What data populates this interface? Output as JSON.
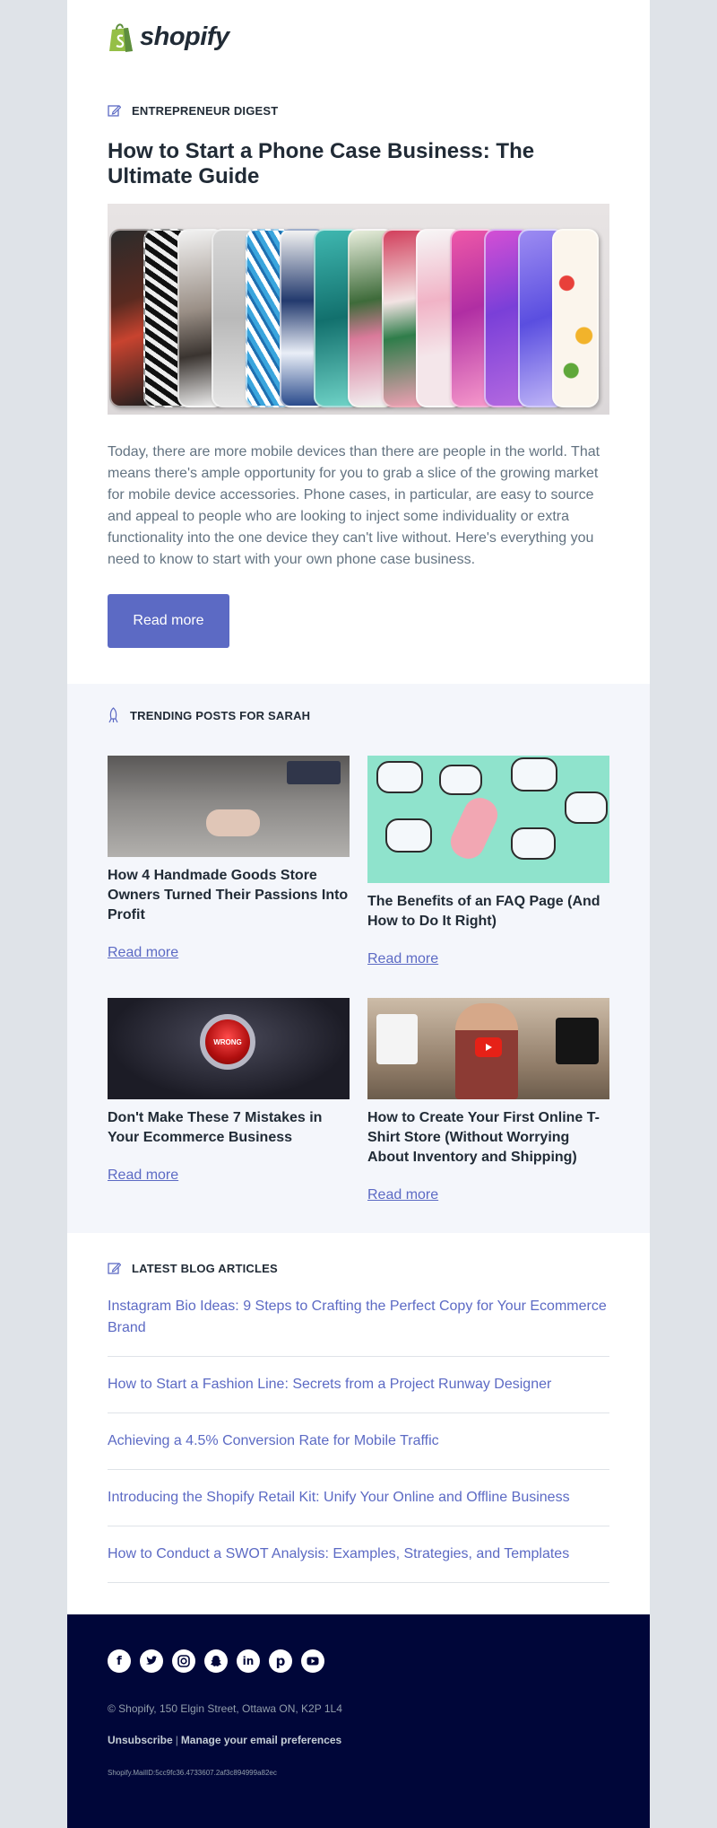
{
  "brand": {
    "name": "shopify",
    "accent": "#5c6ac4",
    "green": "#95bf47"
  },
  "digest": {
    "label": "ENTREPRENEUR DIGEST",
    "title": "How to Start a Phone Case Business: The Ultimate Guide",
    "intro": "Today, there are more mobile devices than there are people in the world. That means there's ample opportunity for you to grab a slice of the growing market for mobile device accessories. Phone cases, in particular, are easy to source and appeal to people who are looking to inject some individuality or extra functionality into the one device they can't live without. Here's everything you need to know to start with your own phone case business.",
    "button": "Read more"
  },
  "trending": {
    "label": "TRENDING POSTS FOR SARAH",
    "cards": [
      {
        "title": "How 4 Handmade Goods Store Owners Turned Their Passions Into Profit",
        "link": "Read more"
      },
      {
        "title": "The Benefits of an FAQ Page (And How to Do It Right)",
        "link": "Read more"
      },
      {
        "title": "Don't Make These 7 Mistakes in Your Ecommerce Business",
        "link": "Read more",
        "image_text": "WRONG"
      },
      {
        "title": "How to Create Your First Online T-Shirt Store (Without Worrying About Inventory and Shipping)",
        "link": "Read more"
      }
    ]
  },
  "latest": {
    "label": "LATEST BLOG ARTICLES",
    "articles": [
      "Instagram Bio Ideas: 9 Steps to Crafting the Perfect Copy for Your Ecommerce Brand",
      "How to Start a Fashion Line: Secrets from a Project Runway Designer",
      "Achieving a 4.5% Conversion Rate for Mobile Traffic",
      "Introducing the Shopify Retail Kit: Unify Your Online and Offline Business",
      "How to Conduct a SWOT Analysis: Examples, Strategies, and Templates"
    ]
  },
  "footer": {
    "socials": [
      "facebook-icon",
      "twitter-icon",
      "instagram-icon",
      "snapchat-icon",
      "linkedin-icon",
      "pinterest-icon",
      "youtube-icon"
    ],
    "address": "© Shopify,  150 Elgin Street, Ottawa ON, K2P 1L4",
    "unsubscribe": "Unsubscribe",
    "separator": "|",
    "preferences": "Manage your email preferences",
    "mail_id": "Shopify.MailID:5cc9fc36.4733607.2af3c894999a82ec"
  }
}
